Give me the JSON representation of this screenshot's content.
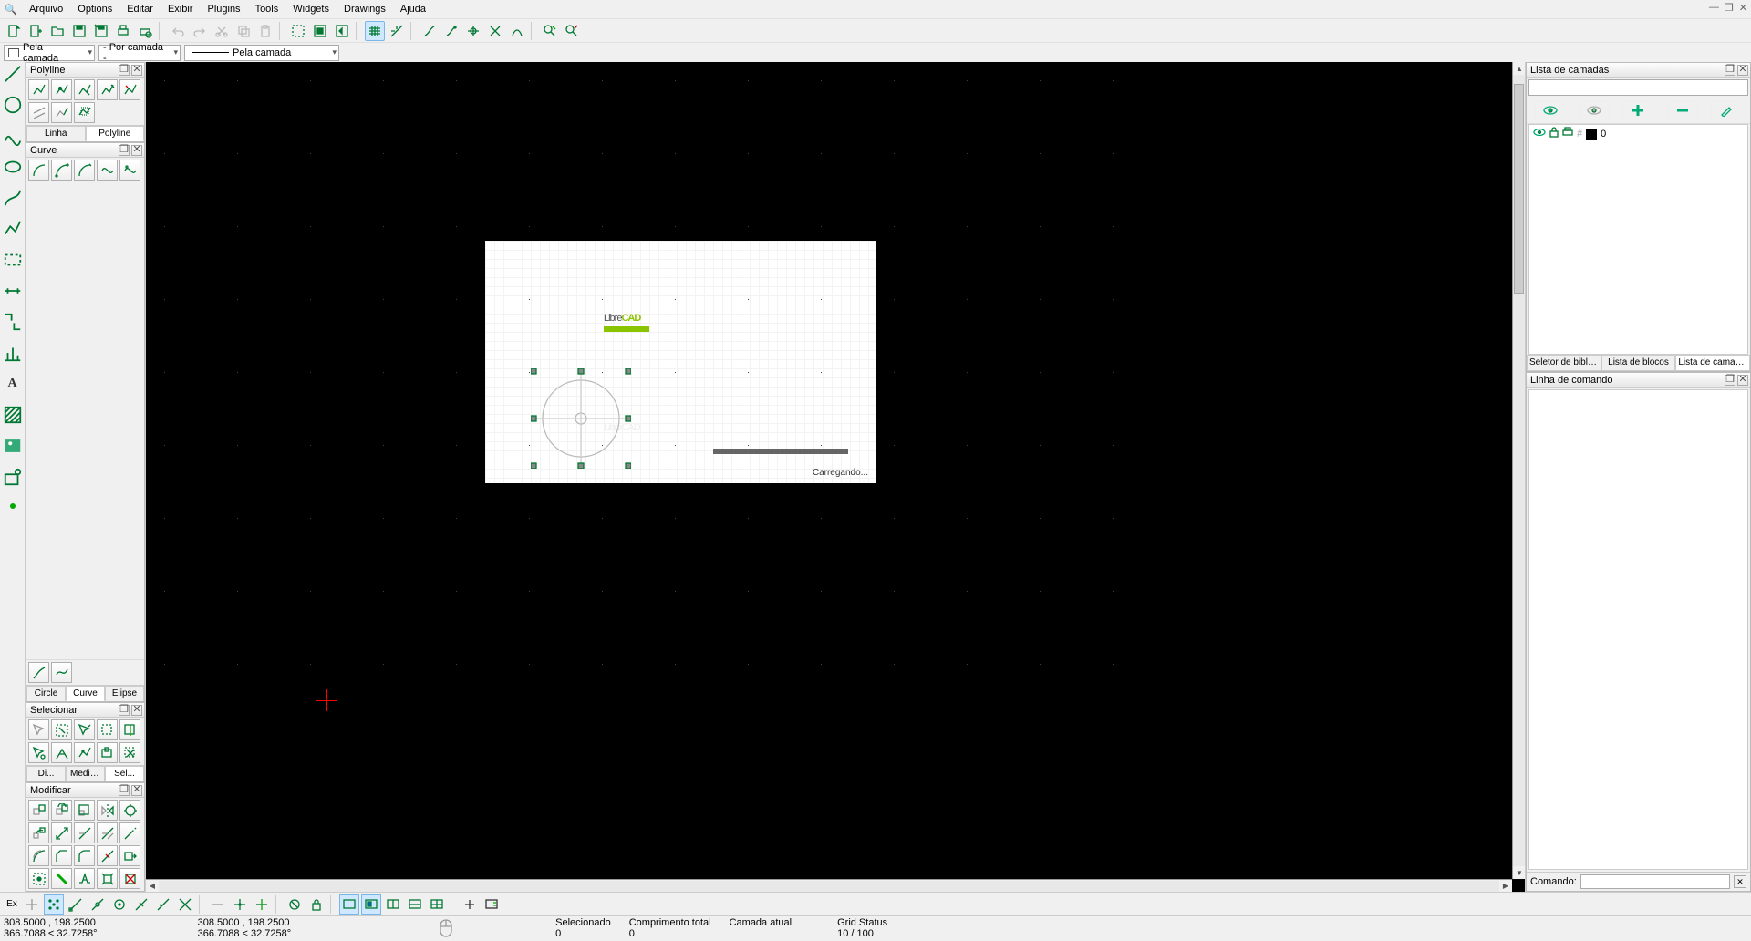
{
  "menu": {
    "items": [
      "Arquivo",
      "Options",
      "Editar",
      "Exibir",
      "Plugins",
      "Tools",
      "Widgets",
      "Drawings",
      "Ajuda"
    ]
  },
  "win_controls": [
    "—",
    "❐",
    "✕"
  ],
  "pen": {
    "color_label": "Pela camada",
    "width_label": "- Por camada -",
    "linetype_label": "Pela camada"
  },
  "docks": {
    "polyline": {
      "title": "Polyline",
      "tabs": [
        "Linha",
        "Polyline"
      ]
    },
    "curve": {
      "title": "Curve",
      "tabs": [
        "Circle",
        "Curve",
        "Elipse"
      ]
    },
    "select": {
      "title": "Selecionar",
      "tabs": [
        "Di...",
        "Medida...",
        "Sel..."
      ]
    },
    "modify": {
      "title": "Modificar"
    }
  },
  "layers": {
    "title": "Lista de camadas",
    "filter_placeholder": "",
    "items": [
      {
        "name": "0"
      }
    ],
    "tabs": [
      "Seletor de biblioteca",
      "Lista de blocos",
      "Lista de camadas"
    ]
  },
  "command": {
    "title": "Linha de comando",
    "prompt": "Comando:"
  },
  "splash": {
    "brand_a": "Libre",
    "brand_b": "CAD",
    "loading": "Carregando..."
  },
  "snap": {
    "ex_label": "Ex"
  },
  "status": {
    "abs1": "308.5000 , 198.2500",
    "rel1": "366.7088 < 32.7258°",
    "abs2": "308.5000 , 198.2500",
    "rel2": "366.7088 < 32.7258°",
    "sel_label": "Selecionado",
    "sel_val": "0",
    "len_label": "Comprimento total",
    "len_val": "0",
    "layer_label": "Camada atual",
    "layer_val": "",
    "grid_label": "Grid Status",
    "grid_val": "10 / 100"
  }
}
